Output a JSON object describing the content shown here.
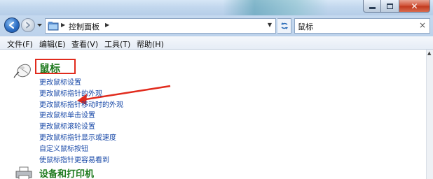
{
  "address": {
    "crumbs": [
      "控制面板"
    ]
  },
  "search": {
    "value": "鼠标"
  },
  "menu": {
    "items": [
      "文件(F)",
      "编辑(E)",
      "查看(V)",
      "工具(T)",
      "帮助(H)"
    ]
  },
  "category": {
    "title": "鼠标",
    "links": [
      "更改鼠标设置",
      "更改鼠标指针的外观",
      "更改鼠标指针移动时的外观",
      "更改鼠标单击设置",
      "更改鼠标滚轮设置",
      "更改鼠标指针显示或速度",
      "自定义鼠标按钮",
      "使鼠标指针更容易看到"
    ]
  },
  "category2": {
    "title": "设备和打印机"
  },
  "colors": {
    "highlight": "#e12b1d",
    "category_title": "#1e7a1e",
    "link": "#1a4aa8"
  },
  "icons": [
    "back-arrow-icon",
    "forward-arrow-icon",
    "folder-icon",
    "refresh-icon",
    "clear-icon",
    "mouse-icon",
    "printer-icon",
    "minimize-icon",
    "maximize-icon",
    "close-icon"
  ]
}
